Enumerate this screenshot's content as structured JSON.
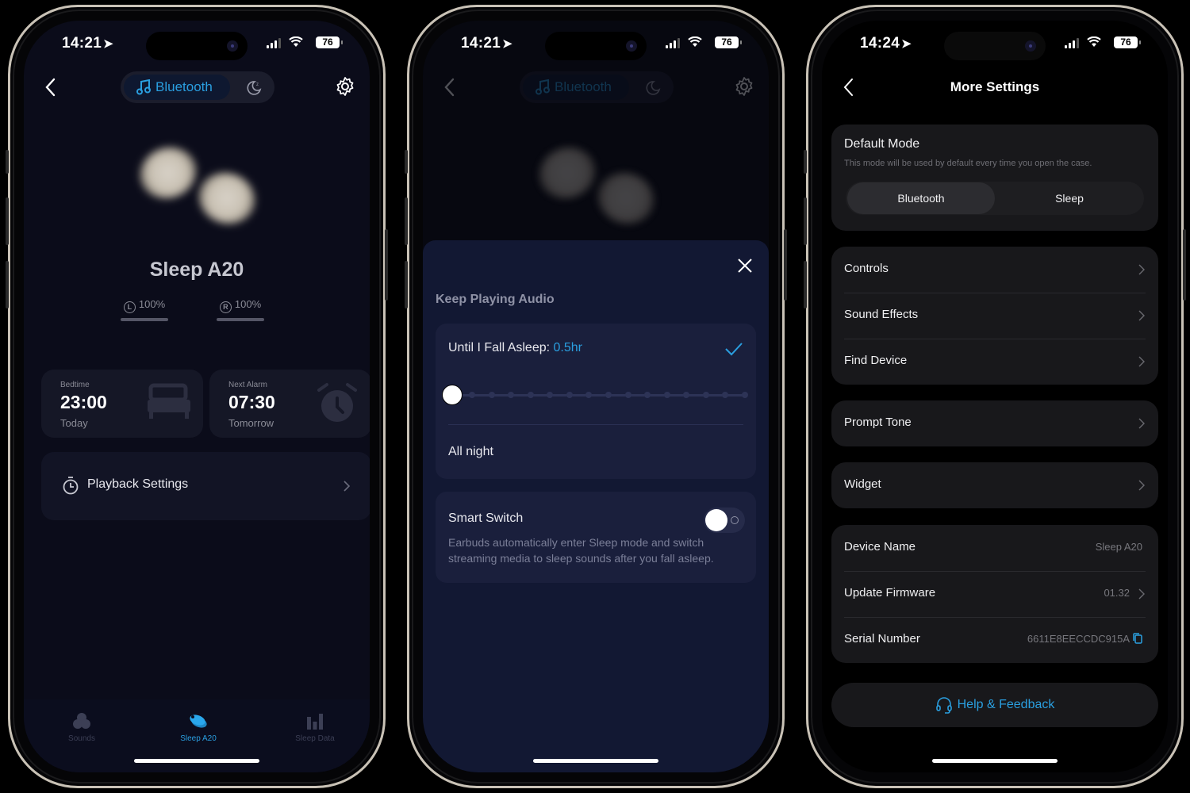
{
  "phones": [
    {
      "status": {
        "time": "14:21",
        "battery": "76"
      },
      "header": {
        "mode_bluetooth_label": "Bluetooth",
        "mode_sleep_icon": "moon-icon",
        "settings_icon": "gear-icon"
      },
      "device": {
        "name": "Sleep A20",
        "left_label": "L",
        "left_battery": "100%",
        "right_label": "R",
        "right_battery": "100%",
        "left_battery_fraction": 1.0,
        "right_battery_fraction": 1.0
      },
      "bedtime": {
        "label": "Bedtime",
        "time": "23:00",
        "day": "Today"
      },
      "alarm": {
        "label": "Next Alarm",
        "time": "07:30",
        "day": "Tomorrow"
      },
      "playback": {
        "label": "Playback Settings"
      },
      "tabs": [
        {
          "label": "Sounds",
          "icon": "sounds-icon",
          "active": false
        },
        {
          "label": "Sleep A20",
          "icon": "earbud-icon",
          "active": true
        },
        {
          "label": "Sleep Data",
          "icon": "bar-chart-icon",
          "active": false
        }
      ]
    },
    {
      "status": {
        "time": "14:21",
        "battery": "76"
      },
      "header": {
        "mode_bluetooth_label": "Bluetooth"
      },
      "sheet": {
        "title": "Keep Playing Audio",
        "until_label": "Until I Fall Asleep: ",
        "until_value": "0.5hr",
        "slider_steps": 16,
        "slider_selected_index": 0,
        "all_night_label": "All night",
        "smart_switch_label": "Smart Switch",
        "smart_switch_on": false,
        "smart_switch_desc": "Earbuds automatically enter Sleep mode and switch streaming media to sleep sounds after you fall asleep."
      }
    },
    {
      "status": {
        "time": "14:24",
        "battery": "76"
      },
      "title": "More Settings",
      "default_mode": {
        "title": "Default Mode",
        "desc": "This mode will be used by default every time you open the case.",
        "options": [
          "Bluetooth",
          "Sleep"
        ],
        "selected": "Bluetooth"
      },
      "groups": [
        [
          {
            "label": "Controls"
          },
          {
            "label": "Sound Effects"
          },
          {
            "label": "Find Device"
          }
        ],
        [
          {
            "label": "Prompt Tone"
          }
        ],
        [
          {
            "label": "Widget"
          }
        ],
        [
          {
            "label": "Device Name",
            "value": "Sleep A20"
          },
          {
            "label": "Update Firmware",
            "value": "01.32"
          },
          {
            "label": "Serial Number",
            "value": "6611E8EECCDC915A"
          }
        ]
      ],
      "help_label": "Help & Feedback"
    }
  ],
  "colors": {
    "accent": "#2a9fe0",
    "sheet_bg": "#121833",
    "settings_card": "#18181b"
  }
}
